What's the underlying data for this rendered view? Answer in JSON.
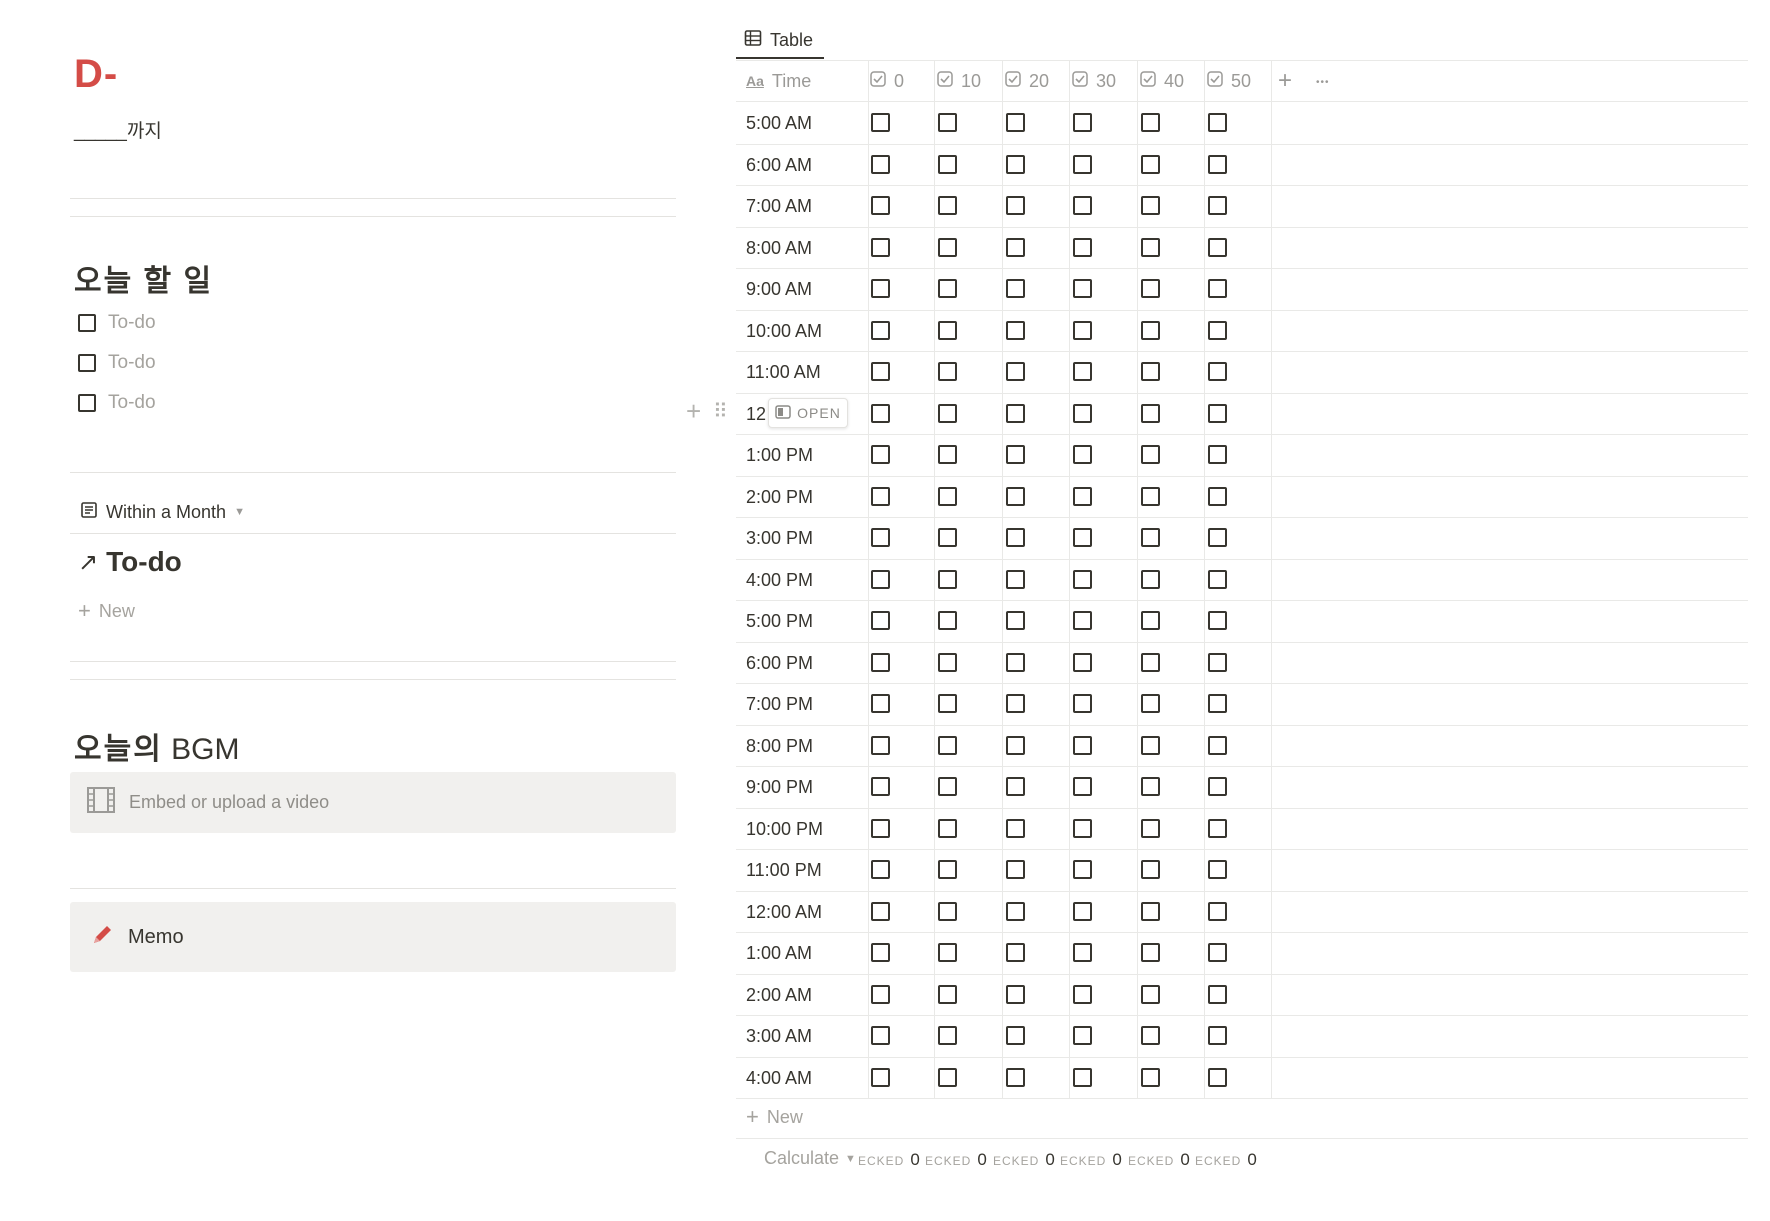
{
  "header": {
    "dday": "D-",
    "until": "_____까지"
  },
  "today": {
    "title": "오늘 할 일",
    "todos": [
      {
        "label": "To-do",
        "checked": false
      },
      {
        "label": "To-do",
        "checked": false
      },
      {
        "label": "To-do",
        "checked": false
      }
    ]
  },
  "linked_db": {
    "view_label": "Within a Month",
    "title": "To-do",
    "new_label": "New"
  },
  "bgm": {
    "title_kr": "오늘의",
    "title_en": "BGM",
    "embed_placeholder": "Embed or upload a video"
  },
  "memo": {
    "label": "Memo"
  },
  "table": {
    "tab_label": "Table",
    "time_header": "Time",
    "columns": [
      "0",
      "10",
      "20",
      "30",
      "40",
      "50"
    ],
    "rows": [
      "5:00 AM",
      "6:00 AM",
      "7:00 AM",
      "8:00 AM",
      "9:00 AM",
      "10:00 AM",
      "11:00 AM",
      "12",
      "1:00 PM",
      "2:00 PM",
      "3:00 PM",
      "4:00 PM",
      "5:00 PM",
      "6:00 PM",
      "7:00 PM",
      "8:00 PM",
      "9:00 PM",
      "10:00 PM",
      "11:00 PM",
      "12:00 AM",
      "1:00 AM",
      "2:00 AM",
      "3:00 AM",
      "4:00 AM"
    ],
    "open_label": "OPEN",
    "new_label": "New",
    "calculate_label": "Calculate",
    "footer": [
      {
        "label": "ECKED",
        "value": "0"
      },
      {
        "label": "ECKED",
        "value": "0"
      },
      {
        "label": "ECKED",
        "value": "0"
      },
      {
        "label": "ECKED",
        "value": "0"
      },
      {
        "label": "ECKED",
        "value": "0"
      },
      {
        "label": "ECKED",
        "value": "0"
      }
    ]
  },
  "colors": {
    "accent_red": "#d44c47",
    "text": "#37352f",
    "muted": "#a5a39e",
    "callout_bg": "#f1f0ee"
  }
}
